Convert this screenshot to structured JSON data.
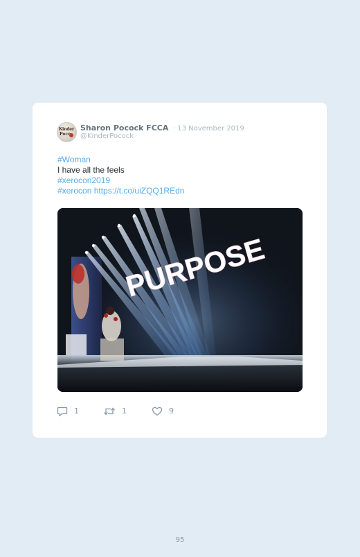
{
  "tweet": {
    "author_name": "Sharon Pocock FCCA",
    "date": "· 13 November 2019",
    "handle": "@KinderPocock",
    "lines": [
      {
        "text": "#Woman",
        "kind": "link"
      },
      {
        "text": "I have all the feels",
        "kind": "text"
      },
      {
        "text": "#xerocon2019",
        "kind": "link"
      }
    ],
    "last_line": {
      "hashtag": "#xerocon",
      "url": "https://t.co/uiZQQ1REdn"
    },
    "image": {
      "sign_text": "PURPOSE"
    },
    "stats": {
      "replies": "1",
      "retweets": "1",
      "likes": "9"
    }
  },
  "page": {
    "number": "95"
  },
  "icons": {
    "reply": "reply-icon",
    "retweet": "retweet-icon",
    "like": "heart-icon"
  },
  "colors": {
    "background": "#e1ecf4",
    "card": "#ffffff",
    "link": "#55acee",
    "muted": "#aab8c2"
  }
}
